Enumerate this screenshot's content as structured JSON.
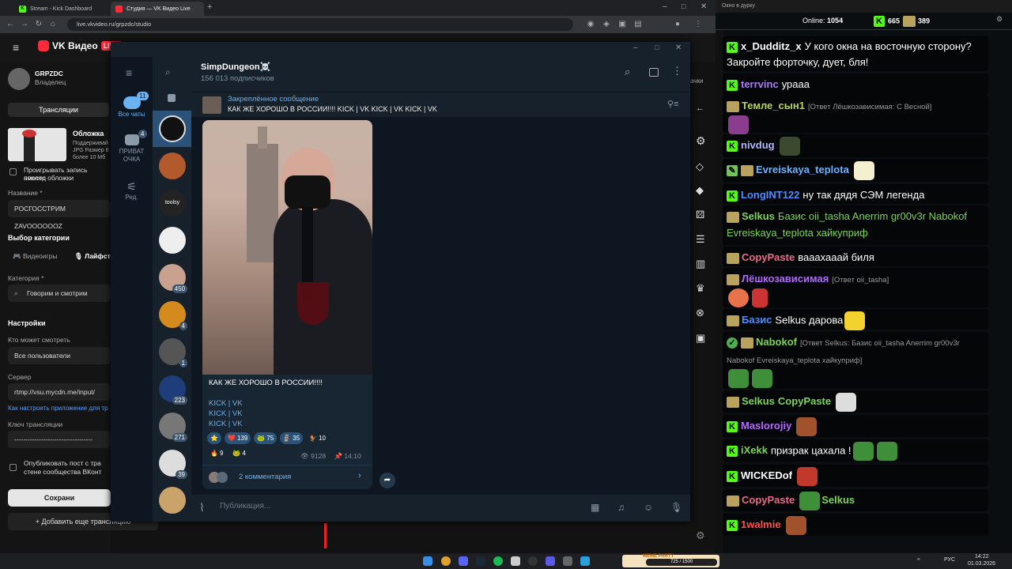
{
  "browser": {
    "tabs": [
      {
        "label": "Stream - Kick Dashboard",
        "icon": "kick-icon"
      },
      {
        "label": "Студия — VK Видео Live",
        "icon": "vk-live-icon"
      }
    ],
    "url": "live.vkvideo.ru/grpzdc/studio"
  },
  "vk": {
    "logo": "VK Видео",
    "live_badge": "LIVE",
    "channel": {
      "name": "GRPZDC",
      "role": "Владелец"
    },
    "studio": {
      "tab_label": "Трансляции",
      "cover_label": "Обложка",
      "cover_hint_lines": [
        "Поддерживай",
        "JPG Размер 6",
        "более 10 Мб"
      ],
      "play_record_label": "Проигрывать запись послед",
      "play_record_label2": "вместо обложки",
      "name_label": "Название *",
      "name_value": "РОСГОССТРИМ ZAVOOOOOOZ",
      "category_section": "Выбор категории",
      "cat_tab_games": "Видеоигры",
      "cat_tab_life": "Лайфст",
      "category_label": "Категория *",
      "category_value": "Говорим и смотрим",
      "settings_section": "Настройки",
      "who_can_watch_label": "Кто может смотреть",
      "who_can_watch_value": "Все пользователи",
      "server_label": "Сервер",
      "server_value": "rtmp://vsu.mycdn.me/input/",
      "server_help": "Как настроить приложение для тр",
      "key_label": "Ключ трансляции",
      "key_value": "-----------------------------------",
      "publish_label": "Опубликовать пост с тра",
      "publish_label2": "стене сообщества ВКонт",
      "save_button": "Сохрани",
      "add_button": "Добавить еще трансляцию",
      "right_peek": "ачки"
    }
  },
  "telegram": {
    "folders": [
      {
        "label": "Все чаты",
        "badge": "11"
      },
      {
        "label": "ПРИВАТ ОЧКА",
        "badge": "4"
      },
      {
        "label": "Ред.",
        "badge": ""
      }
    ],
    "chat_badges": [
      "",
      "",
      "",
      "",
      "450",
      "4",
      "1",
      "223",
      "271",
      "39",
      ""
    ],
    "channel_name": "SimpDungeon☠️",
    "subscribers": "156 013 подписчиков",
    "pinned_title": "Закреплённое сообщение",
    "pinned_text": "КАК ЖЕ ХОРОШО В РОССИИ!!!!  KICK | VK KICK | VK KICK | VK",
    "post": {
      "text": "КАК ЖЕ ХОРОШО В РОССИИ!!!!",
      "links": [
        "KICK | VK",
        "KICK | VK",
        "KICK | VK"
      ],
      "reactions": [
        {
          "emoji": "⭐",
          "count": ""
        },
        {
          "emoji": "❤️",
          "count": "139"
        },
        {
          "emoji": "🐸",
          "count": "75"
        },
        {
          "emoji": "🗿",
          "count": "35"
        },
        {
          "emoji": "🐓",
          "count": "10"
        },
        {
          "emoji": "🔥",
          "count": "9"
        },
        {
          "emoji": "🐸",
          "count": "4"
        }
      ],
      "views": "9128",
      "time": "14:10",
      "comments": "2 комментария"
    },
    "compose_placeholder": "Публикация..."
  },
  "kick_chat": {
    "window_title": "Окно в дурку",
    "online_label": "Online:",
    "online_value": "1054",
    "stat1": "665",
    "stat2": "389",
    "messages": [
      {
        "nick": "x_Dudditz_x",
        "color": "#ffffff",
        "reply": "",
        "text": "У кого окна на восточную сторону? Закройте форточку, дует, бля!"
      },
      {
        "nick": "terrvinc",
        "color": "#a97cf9",
        "reply": "",
        "text": "урааа"
      },
      {
        "nick": "Темле_сын1",
        "color": "#b8d35c",
        "reply": "[Ответ Лёшкозависимая: С Весной]",
        "text": ""
      },
      {
        "nick": "nivdug",
        "color": "#b0b8ff",
        "reply": "",
        "text": ""
      },
      {
        "nick": "Evreiskaya_teplota",
        "color": "#6cb3ff",
        "reply": "",
        "text": ""
      },
      {
        "nick": "LongINT122",
        "color": "#4f8cff",
        "reply": "",
        "text": "ну так дядя СЭМ легенда"
      },
      {
        "nick": "Selkus",
        "color": "#7cd35c",
        "reply": "",
        "text": "Базис oii_tasha Anerrim gr00v3r Nabokof Evreiskaya_teplota хайкуприф"
      },
      {
        "nick": "CopyPaste",
        "color": "#e96a8a",
        "reply": "",
        "text": "вааахааай биля"
      },
      {
        "nick": "Лёшкозависимая",
        "color": "#b26aff",
        "reply": "[Ответ oii_tasha]",
        "text": ""
      },
      {
        "nick": "Базис",
        "color": "#4f8cff",
        "reply": "",
        "text": "Selkus дарова"
      },
      {
        "nick": "Nabokof",
        "color": "#7cd35c",
        "reply": "[Ответ Selkus: Базис oii_tasha Anerrim gr00v3r Nabokof Evreiskaya_teplota хайкуприф]",
        "text": ""
      },
      {
        "nick": "Selkus",
        "color": "#7cd35c",
        "reply": "",
        "text": "CopyPaste"
      },
      {
        "nick": "Maslorojiy",
        "color": "#b26aff",
        "reply": "",
        "text": ""
      },
      {
        "nick": "iXekk",
        "color": "#7cd35c",
        "reply": "",
        "text": "призрак цахала !"
      },
      {
        "nick": "WICKEDof",
        "color": "#ffffff",
        "reply": "",
        "text": ""
      },
      {
        "nick": "CopyPaste",
        "color": "#e96a8a",
        "reply": "",
        "text": "Selkus"
      },
      {
        "nick": "1walmie",
        "color": "#ff4d4d",
        "reply": "",
        "text": ""
      }
    ]
  },
  "taskbar": {
    "lang": "РУС",
    "time": "14:22",
    "date": "01.03.2026",
    "meme_party": "MEME PARTY",
    "meme_counter": "725 / 1500"
  }
}
